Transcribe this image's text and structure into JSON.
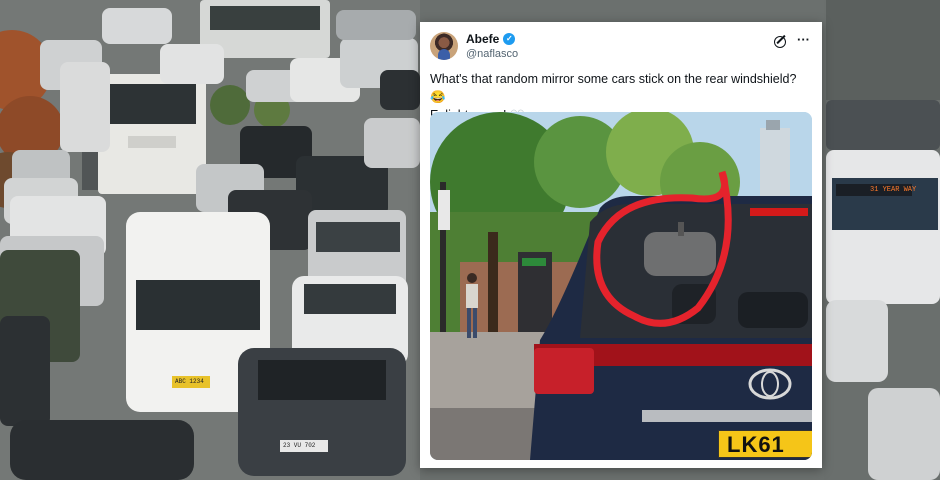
{
  "tweet": {
    "author_name": "Abefe",
    "author_handle": "@naflasco",
    "text_line1": "What's that random mirror some cars stick on the rear windshield? 😂",
    "text_line2": "Enlighten me! 👀",
    "media_plate_text": "LK61"
  },
  "background": {
    "van_plate": "ABC 1234",
    "car_plate": "23 VU 702",
    "bus_display": "31 YEAR WAY"
  },
  "icons": {
    "verified": "verified-badge-icon",
    "grok": "grok-icon",
    "more": "more-icon"
  },
  "colors": {
    "verified_blue": "#1d9bf0",
    "circle_red": "#e5232c",
    "plate_yellow": "#f5c518"
  }
}
